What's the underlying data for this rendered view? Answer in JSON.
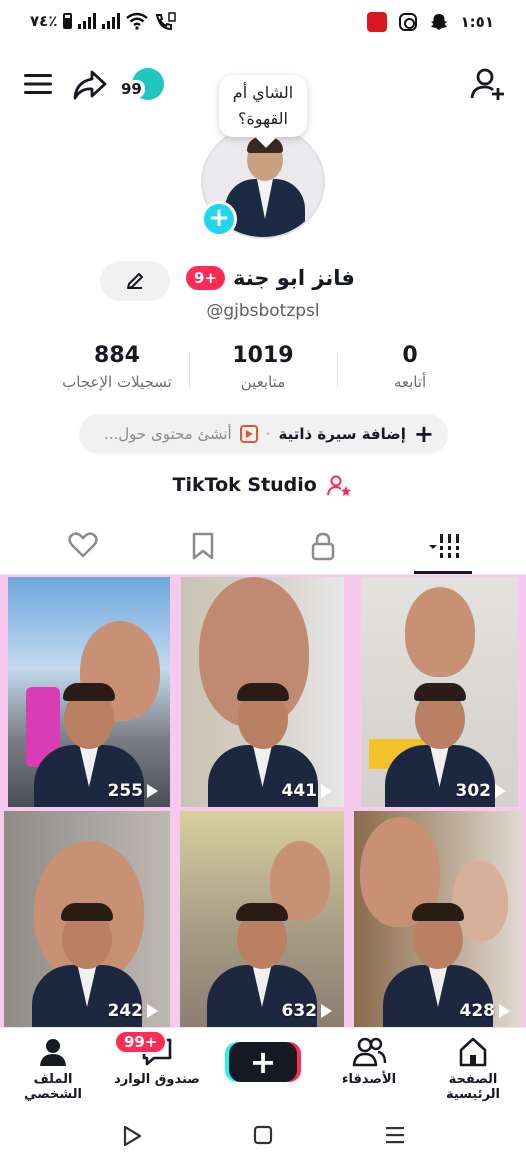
{
  "status_bar": {
    "time": "١:٥١",
    "battery": "٧٤٪"
  },
  "header": {
    "notification_count": "99"
  },
  "profile": {
    "bubble_line1": "الشاي أم",
    "bubble_line2": "القهوة؟",
    "display_name": "فانز ابو جنة",
    "name_badge": "9+",
    "username": "@gjbsbotzpsl",
    "stats": [
      {
        "value": "884",
        "label": "تسجيلات الإعجاب"
      },
      {
        "value": "1019",
        "label": "متابعين"
      },
      {
        "value": "0",
        "label": "أتابعه"
      }
    ],
    "bio_add_label": "إضافة سيرة ذاتية",
    "bio_separator": "·",
    "bio_hint": "أنشئ محتوى حول...",
    "studio_label": "TikTok Studio"
  },
  "tabs": [
    "liked",
    "favorites",
    "private",
    "videos"
  ],
  "videos": [
    {
      "views": "255"
    },
    {
      "views": "441"
    },
    {
      "views": "302"
    },
    {
      "views": "242"
    },
    {
      "views": "632"
    },
    {
      "views": "428"
    }
  ],
  "bottom_nav": {
    "profile": "الملف الشخصي",
    "inbox": "صندوق الوارد",
    "inbox_badge": "99+",
    "friends": "الأصدقاء",
    "home": "الصفحة الرئيسية"
  },
  "colors": {
    "accent": "#fe2c55",
    "cyan": "#20d5ec",
    "grid_bg": "#f7c9ee"
  }
}
